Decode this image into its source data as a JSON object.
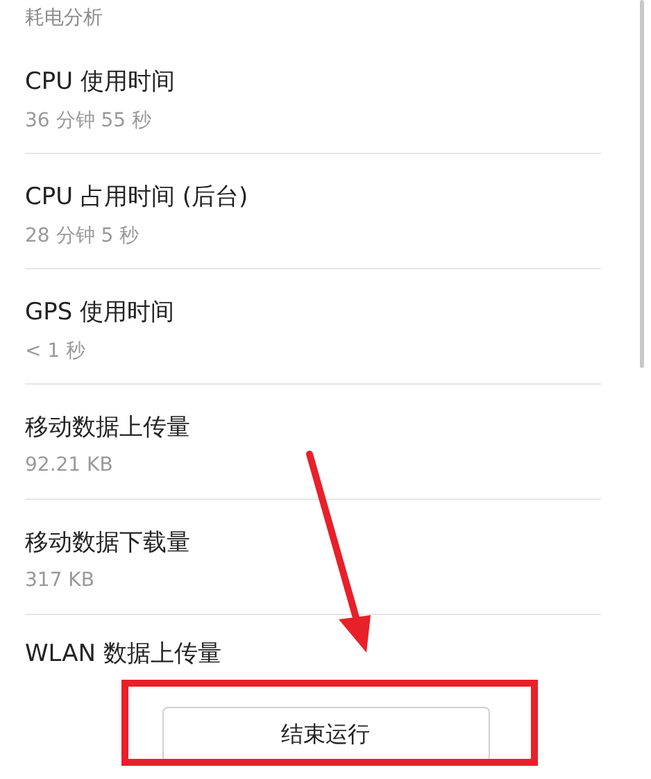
{
  "section_header": "耗电分析",
  "items": [
    {
      "title": "CPU 使用时间",
      "value": "36 分钟 55 秒"
    },
    {
      "title": "CPU 占用时间 (后台)",
      "value": "28 分钟 5 秒"
    },
    {
      "title": "GPS 使用时间",
      "value": "< 1 秒"
    },
    {
      "title": "移动数据上传量",
      "value": "92.21 KB"
    },
    {
      "title": "移动数据下载量",
      "value": "317 KB"
    },
    {
      "title": "WLAN 数据上传量"
    }
  ],
  "button": {
    "label": "结束运行"
  }
}
